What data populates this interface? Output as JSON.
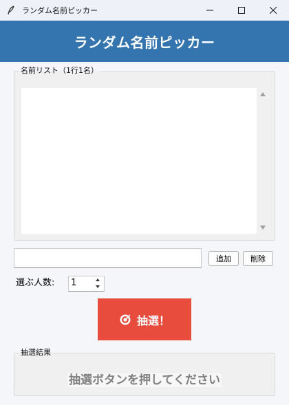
{
  "window": {
    "title": "ランダム名前ピッカー"
  },
  "header": {
    "title": "ランダム名前ピッカー",
    "background": "#3475b0"
  },
  "name_list": {
    "legend": "名前リスト（1行1名）",
    "items": []
  },
  "add_row": {
    "input_value": "",
    "add_label": "追加",
    "delete_label": "削除"
  },
  "pick_count": {
    "label": "選ぶ人数:",
    "value": "1"
  },
  "draw_button": {
    "label": "抽選！",
    "icon": "target-icon",
    "color": "#e74c3c"
  },
  "result": {
    "legend": "抽選結果",
    "text": "抽選ボタンを押してください"
  }
}
